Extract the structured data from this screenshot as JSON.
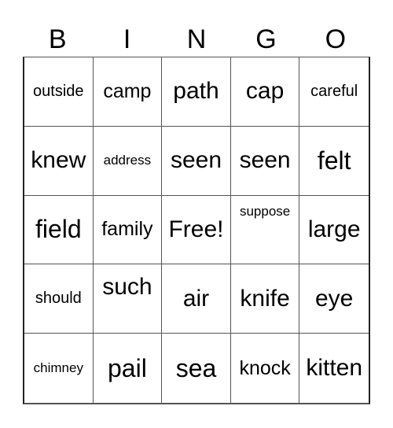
{
  "header": {
    "letters": [
      "B",
      "I",
      "N",
      "G",
      "O"
    ]
  },
  "cells": [
    [
      "outside",
      "camp",
      "path",
      "cap",
      "careful"
    ],
    [
      "knew",
      "address",
      "seen",
      "seen",
      "felt"
    ],
    [
      "field",
      "family",
      "Free!",
      "suppose",
      "large"
    ],
    [
      "should",
      "such",
      "air",
      "knife",
      "eye"
    ],
    [
      "chimney",
      "pail",
      "sea",
      "knock",
      "kitten"
    ]
  ]
}
